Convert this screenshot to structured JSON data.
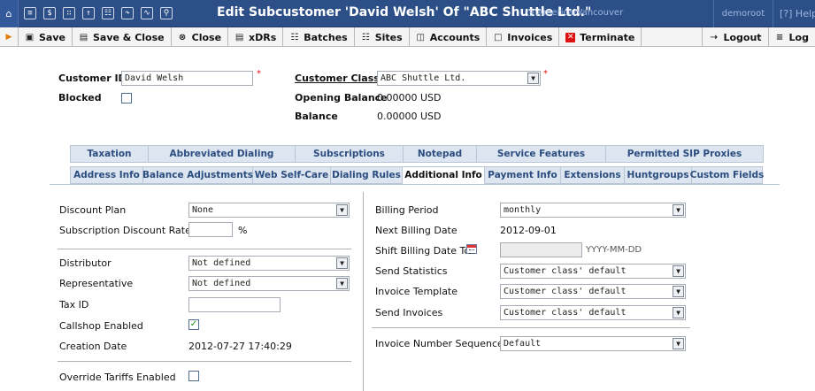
{
  "titlebar": {
    "title": "Edit Subcustomer 'David Welsh' Of \"ABC Shuttle Ltd.\"",
    "timezone": "America/Vancouver",
    "user": "demoroot",
    "help": "Help"
  },
  "toolbar": {
    "save": "Save",
    "save_close": "Save & Close",
    "close": "Close",
    "xdrs": "xDRs",
    "batches": "Batches",
    "sites": "Sites",
    "accounts": "Accounts",
    "invoices": "Invoices",
    "terminate": "Terminate",
    "logout": "Logout",
    "log": "Log"
  },
  "header": {
    "customer_id_label": "Customer ID",
    "customer_id_value": "David Welsh",
    "blocked_label": "Blocked",
    "customer_class_label": "Customer Class",
    "customer_class_value": "ABC Shuttle Ltd.",
    "opening_balance_label": "Opening Balance",
    "opening_balance_value": "0.00000 USD",
    "balance_label": "Balance",
    "balance_value": "0.00000 USD",
    "required_mark": "*"
  },
  "tabs_row1": [
    "Taxation",
    "Abbreviated Dialing",
    "Subscriptions",
    "Notepad",
    "Service Features",
    "Permitted SIP Proxies"
  ],
  "tabs_row2": [
    "Address Info",
    "Balance Adjustments",
    "Web Self-Care",
    "Dialing Rules",
    "Additional Info",
    "Payment Info",
    "Extensions",
    "Huntgroups",
    "Custom Fields"
  ],
  "left": {
    "discount_plan_label": "Discount Plan",
    "discount_plan_value": "None",
    "subscription_discount_label": "Subscription Discount Rate",
    "subscription_discount_value": "",
    "percent": "%",
    "distributor_label": "Distributor",
    "distributor_value": "Not defined",
    "representative_label": "Representative",
    "representative_value": "Not defined",
    "taxid_label": "Tax ID",
    "taxid_value": "",
    "callshop_label": "Callshop Enabled",
    "creation_label": "Creation Date",
    "creation_value": "2012-07-27 17:40:29",
    "override_label": "Override Tariffs Enabled"
  },
  "right": {
    "billing_period_label": "Billing Period",
    "billing_period_value": "monthly",
    "next_billing_label": "Next Billing Date",
    "next_billing_value": "2012-09-01",
    "shift_label": "Shift Billing Date To",
    "shift_placeholder": "YYYY-MM-DD",
    "send_stats_label": "Send Statistics",
    "send_stats_value": "Customer class' default",
    "invoice_template_label": "Invoice Template",
    "invoice_template_value": "Customer class' default",
    "send_invoices_label": "Send Invoices",
    "send_invoices_value": "Customer class' default",
    "invoice_seq_label": "Invoice Number Sequence",
    "invoice_seq_value": "Default"
  },
  "colors": {
    "titlebar": "#2c4f87",
    "tab_bg": "#dde5f1",
    "tab_text": "#2b4d80",
    "required": "#dd1111"
  }
}
